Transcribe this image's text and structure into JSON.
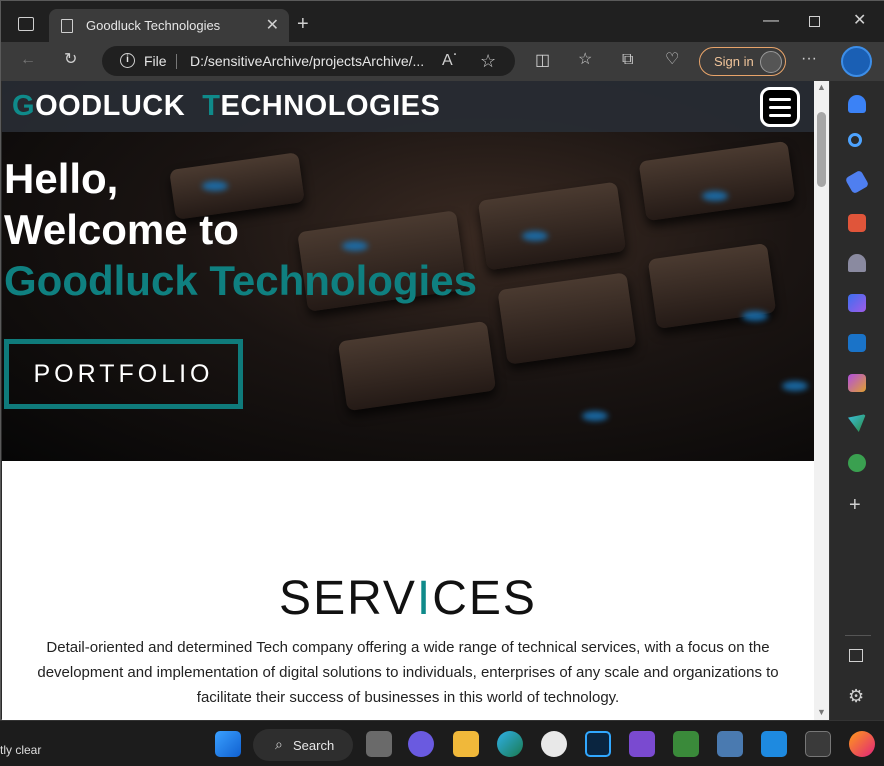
{
  "browser": {
    "tab_title": "Goodluck Technologies",
    "address_scheme": "File",
    "address_url": "D:/sensitiveArchive/projectsArchive/...",
    "signin_label": "Sign in"
  },
  "site": {
    "brand_first_initial": "G",
    "brand_first_rest": "OODLUCK",
    "brand_second_initial": "T",
    "brand_second_rest": "ECHNOLOGIES",
    "hero_line1": "Hello,",
    "hero_line2": "Welcome to",
    "hero_line3": "Goodluck Technologies",
    "portfolio_button": "PORTFOLIO",
    "services_pre": "SERV",
    "services_accent": "I",
    "services_post": "CES",
    "services_desc": "Detail-oriented and determined Tech company offering a wide range of technical services, with a focus on the development and implementation of digital solutions to individuals, enterprises of any scale and organizations to facilitate their success of businesses in this world of technology."
  },
  "taskbar": {
    "search_label": "Search",
    "weather_text": "tly clear"
  },
  "colors": {
    "accent": "#0f8a8a",
    "signin_border": "#e8a46a"
  }
}
